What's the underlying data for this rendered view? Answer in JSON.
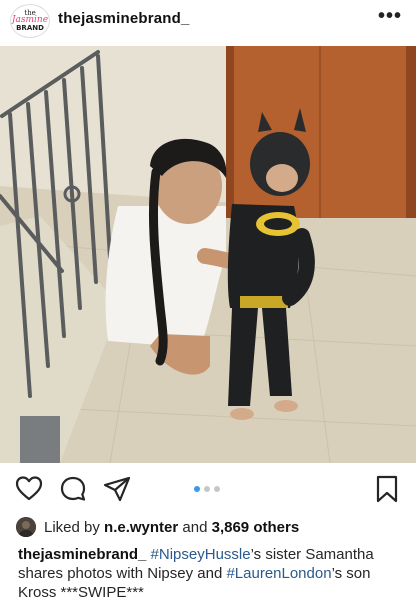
{
  "header": {
    "logo": {
      "line1": "the",
      "line2": "Jasmine",
      "line3": "BRAND"
    },
    "username": "thejasminebrand_",
    "more_icon": "more-horizontal-icon",
    "more_glyph": "•••"
  },
  "post": {
    "image_description_icon": "photo",
    "carousel": {
      "total": 3,
      "active": 1
    }
  },
  "actions": {
    "icons": [
      "heart-icon",
      "comment-icon",
      "share-icon",
      "bookmark-icon"
    ]
  },
  "likes": {
    "prefix": "Liked by ",
    "user": "n.e.wynter",
    "middle": " and ",
    "count": "3,869 others"
  },
  "caption": {
    "username": "thejasminebrand_",
    "tag1": "#NipseyHussle",
    "text1": "’s sister Samantha shares photos with Nipsey and ",
    "tag2": "#LaurenLondon",
    "text2": "’s son Kross ***SWIPE***"
  },
  "colors": {
    "accent_blue": "#3897f0",
    "hashtag": "#2b5a8c",
    "text": "#262626"
  }
}
